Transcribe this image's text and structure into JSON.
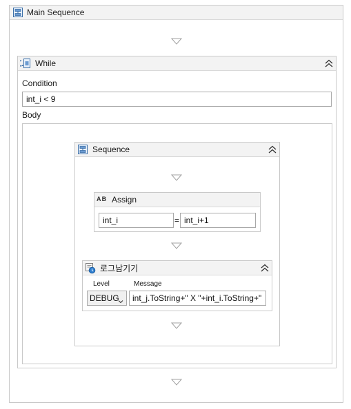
{
  "main_sequence": {
    "title": "Main Sequence"
  },
  "while": {
    "title": "While",
    "condition_label": "Condition",
    "condition_value": "int_i < 9",
    "body_label": "Body"
  },
  "sequence": {
    "title": "Sequence"
  },
  "assign": {
    "title": "Assign",
    "icon_text": "A B",
    "target": "int_i",
    "equals": "=",
    "value": "int_i+1"
  },
  "log": {
    "title": "로그남기기",
    "level_label": "Level",
    "message_label": "Message",
    "level_value": "DEBUG",
    "message_value": "int_j.ToString+\" X \"+int_i.ToString+\""
  },
  "icons": {
    "sequence": "sequence-icon",
    "while": "while-icon",
    "assign": "assign-icon",
    "log": "log-message-icon",
    "collapse": "double-chevron-up-icon",
    "drop": "drop-target-arrow-icon",
    "dropdown": "chevron-down-icon"
  }
}
